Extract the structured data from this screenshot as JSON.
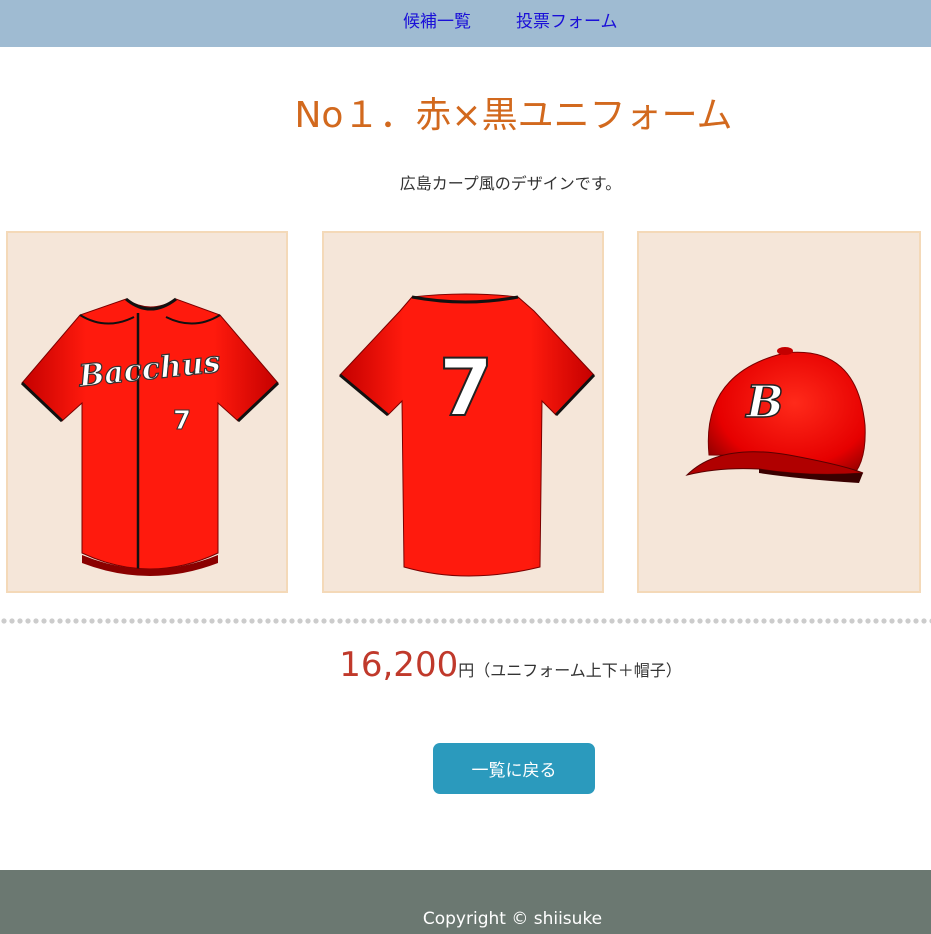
{
  "nav": {
    "candidate_list": "候補一覧",
    "vote_form": "投票フォーム"
  },
  "product": {
    "title": "No１．赤×黒ユニフォーム",
    "description": "広島カープ風のデザインです。",
    "images": {
      "front": {
        "logo_text": "Bacchus",
        "number": "7"
      },
      "back": {
        "number": "7"
      },
      "cap": {
        "letter": "B"
      }
    },
    "price": {
      "value": "16,200",
      "unit": "円",
      "note": "（ユニフォーム上下＋帽子）"
    }
  },
  "actions": {
    "back_to_list": "一覧に戻る"
  },
  "footer": {
    "copyright": "Copyright © shiisuke"
  },
  "colors": {
    "nav_bg": "#9fbbd2",
    "title": "#d2691e",
    "price": "#c0392b",
    "button": "#2b9abd",
    "footer_bg": "#6b7871",
    "card_bg": "#f5e6d9",
    "uniform_red": "#ff1a0d"
  }
}
